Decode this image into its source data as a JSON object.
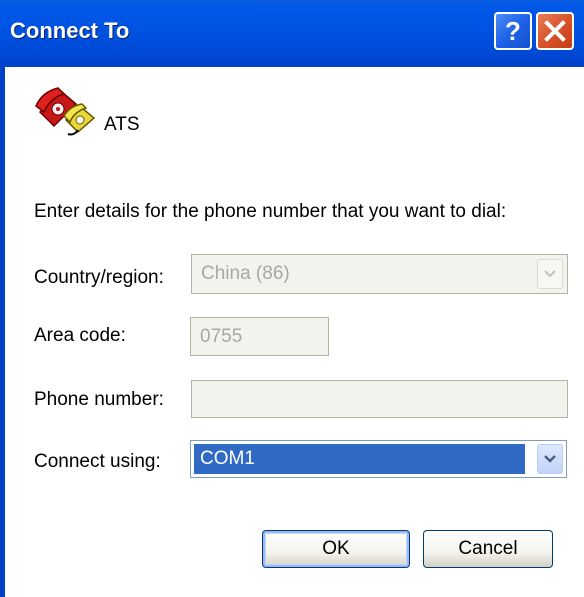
{
  "window": {
    "title": "Connect To"
  },
  "titlebar": {
    "help_icon": "help-question-icon",
    "close_icon": "close-x-icon"
  },
  "connection": {
    "icon": "telephone-icon",
    "name": "ATS"
  },
  "instruction": "Enter details for the phone number that you want to dial:",
  "fields": {
    "country": {
      "label": "Country/region:",
      "value": "China (86)",
      "enabled": false
    },
    "area_code": {
      "label": "Area code:",
      "value": "0755",
      "enabled": false
    },
    "phone": {
      "label": "Phone number:",
      "value": "",
      "enabled": false
    },
    "connect_using": {
      "label": "Connect using:",
      "value": "COM1",
      "enabled": true
    }
  },
  "buttons": {
    "ok": "OK",
    "cancel": "Cancel"
  },
  "colors": {
    "titlebar": "#0054e3",
    "selection": "#316ac5",
    "close_button": "#d8522a"
  }
}
